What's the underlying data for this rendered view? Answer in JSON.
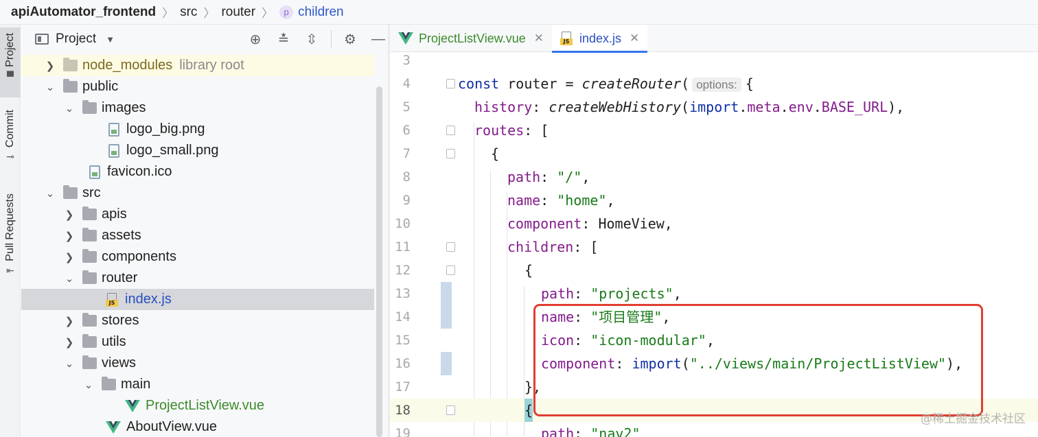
{
  "breadcrumb": {
    "project": "apiAutomator_frontend",
    "items": [
      "src",
      "router"
    ],
    "method_badge": "p",
    "method": "children"
  },
  "tool_stripe": {
    "project_label": "Project",
    "commit_label": "Commit",
    "pull_requests_label": "Pull Requests"
  },
  "project_panel": {
    "title": "Project",
    "tree": [
      {
        "label": "node_modules",
        "hint": "library root"
      },
      {
        "label": "public"
      },
      {
        "label": "images"
      },
      {
        "label": "logo_big.png"
      },
      {
        "label": "logo_small.png"
      },
      {
        "label": "favicon.ico"
      },
      {
        "label": "src"
      },
      {
        "label": "apis"
      },
      {
        "label": "assets"
      },
      {
        "label": "components"
      },
      {
        "label": "router"
      },
      {
        "label": "index.js"
      },
      {
        "label": "stores"
      },
      {
        "label": "utils"
      },
      {
        "label": "views"
      },
      {
        "label": "main"
      },
      {
        "label": "ProjectListView.vue"
      },
      {
        "label": "AboutView.vue"
      }
    ]
  },
  "editor": {
    "tabs": [
      {
        "label": "ProjectListView.vue"
      },
      {
        "label": "index.js"
      }
    ],
    "line_numbers": [
      "3",
      "4",
      "5",
      "6",
      "7",
      "8",
      "9",
      "10",
      "11",
      "12",
      "13",
      "14",
      "15",
      "16",
      "17",
      "18",
      "19"
    ],
    "param_hint": "options:",
    "code": {
      "l4_const": "const",
      "l4_var": " router = ",
      "l4_fn": "createRouter",
      "l4_open": "(",
      "l4_brace": "{",
      "l5_key": "history",
      "l5_colon": ": ",
      "l5_fn": "createWebHistory",
      "l5_open": "(",
      "l5_import": "import",
      "l5_dot1": ".",
      "l5_meta": "meta",
      "l5_dot2": ".",
      "l5_env": "env",
      "l5_dot3": ".",
      "l5_base": "BASE_URL",
      "l5_close": "),",
      "l6_key": "routes",
      "l6_rest": ": [",
      "l7": "{",
      "l8_key": "path",
      "l8_colon": ": ",
      "l8_val": "\"/\"",
      "l8_comma": ",",
      "l9_key": "name",
      "l9_colon": ": ",
      "l9_val": "\"home\"",
      "l9_comma": ",",
      "l10_key": "component",
      "l10_rest": ": HomeView,",
      "l11_key": "children",
      "l11_rest": ": [",
      "l12": "{",
      "l13_key": "path",
      "l13_colon": ": ",
      "l13_val": "\"projects\"",
      "l13_comma": ",",
      "l14_key": "name",
      "l14_colon": ": ",
      "l14_val": "\"项目管理\"",
      "l14_comma": ",",
      "l15_key": "icon",
      "l15_colon": ": ",
      "l15_val": "\"icon-modular\"",
      "l15_comma": ",",
      "l16_key": "component",
      "l16_colon": ": ",
      "l16_import": "import",
      "l16_open": "(",
      "l16_val": "\"../views/main/ProjectListView\"",
      "l16_close": "),",
      "l17": "},",
      "l18": "{",
      "l19_key": "path",
      "l19_colon": ": ",
      "l19_val": "\"nav2\""
    }
  },
  "watermark": "@稀土掘金技术社区",
  "colors": {
    "accent": "#3574f0",
    "highlight_box": "#df3e30",
    "string": "#187a18",
    "keyword": "#0e2fa5",
    "property": "#831c8c"
  }
}
